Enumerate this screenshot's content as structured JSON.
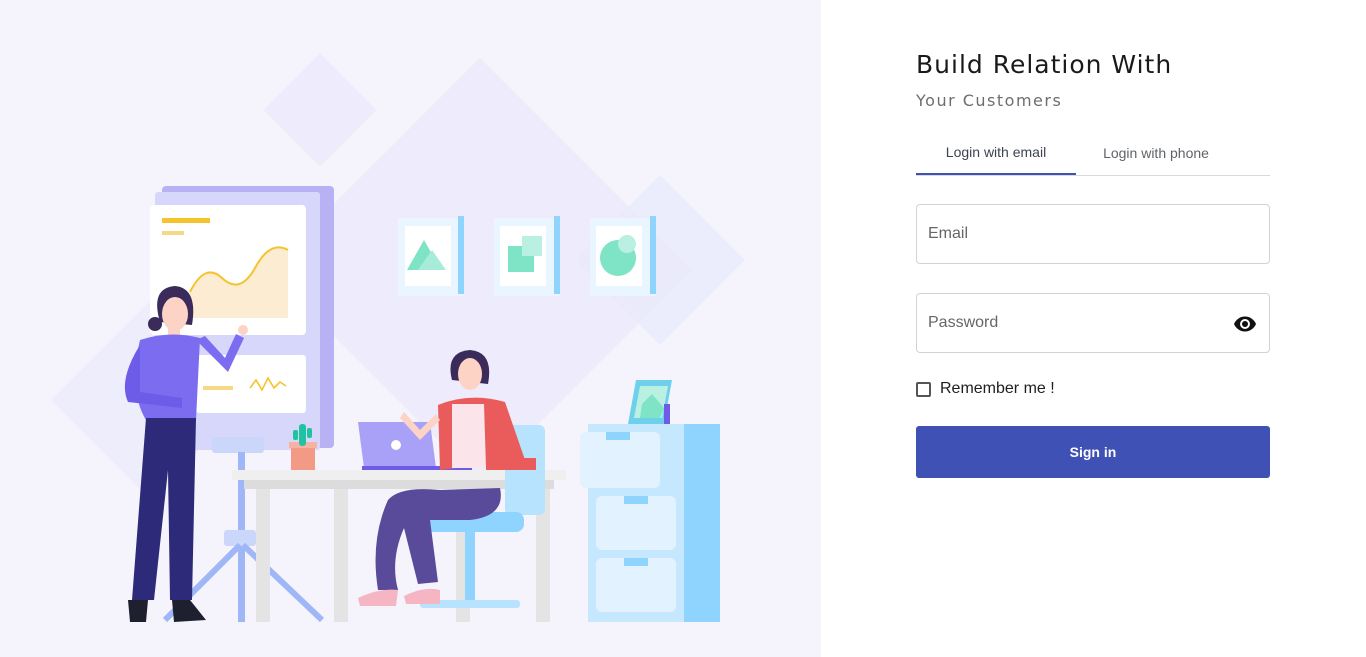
{
  "login": {
    "title": "Build Relation With",
    "subtitle": "Your Customers",
    "tabs": [
      {
        "label": "Login with email",
        "active": true
      },
      {
        "label": "Login with phone",
        "active": false
      }
    ],
    "email": {
      "placeholder": "Email",
      "value": ""
    },
    "password": {
      "placeholder": "Password",
      "value": ""
    },
    "remember": {
      "label": "Remember me !",
      "checked": false
    },
    "signin_label": "Sign in"
  },
  "icons": {
    "password_toggle": "eye-icon",
    "checkbox": "checkbox-icon"
  },
  "colors": {
    "accent": "#3f51b5",
    "left_panel_bg": "#f5f4fd",
    "illustration_purple": "#6c5ce7",
    "illustration_blue": "#8fd3ff",
    "illustration_red": "#e85a5a"
  }
}
